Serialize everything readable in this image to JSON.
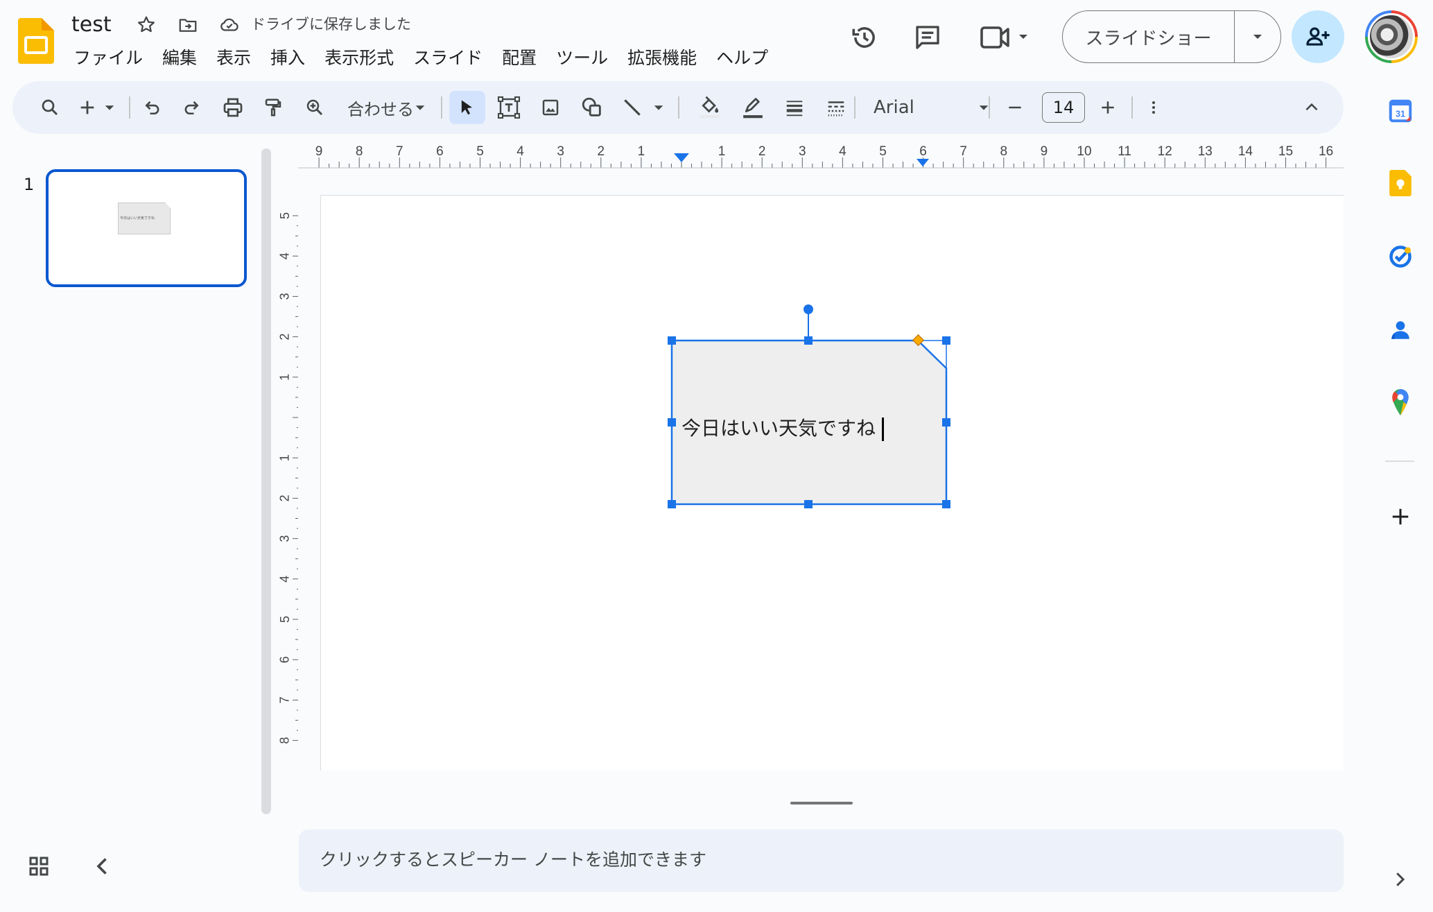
{
  "header": {
    "doc_title": "test",
    "save_status": "ドライブに保存しました",
    "menu": [
      "ファイル",
      "編集",
      "表示",
      "挿入",
      "表示形式",
      "スライド",
      "配置",
      "ツール",
      "拡張機能",
      "ヘルプ"
    ],
    "slideshow_label": "スライドショー"
  },
  "toolbar": {
    "zoom_fit_label": "合わせる",
    "font_name": "Arial",
    "font_size": "14"
  },
  "rulers": {
    "horizontal_labels": [
      "9",
      "8",
      "7",
      "6",
      "5",
      "4",
      "3",
      "2",
      "1",
      "1",
      "2",
      "3",
      "4",
      "5",
      "6",
      "7",
      "8",
      "9",
      "10",
      "11",
      "12",
      "13",
      "14",
      "15",
      "16"
    ],
    "vertical_labels": [
      "5",
      "4",
      "3",
      "2",
      "1",
      "1",
      "2",
      "3",
      "4",
      "5",
      "6",
      "7",
      "8"
    ]
  },
  "filmstrip": {
    "slides": [
      {
        "number": "1",
        "thumb_text": "今日はいい天気ですね"
      }
    ]
  },
  "slide": {
    "shape_text": "今日はいい天気ですね",
    "shape_fill": "#eeeeee",
    "selection_color": "#1a73e8",
    "adjust_handle_color": "#f9ab00"
  },
  "notes": {
    "placeholder": "クリックするとスピーカー ノートを追加できます"
  },
  "side_panel": {
    "icons": [
      "calendar-icon",
      "keep-icon",
      "tasks-icon",
      "contacts-icon",
      "maps-icon",
      "add-icon"
    ],
    "calendar_day": "31"
  },
  "colors": {
    "accent": "#0b57d0",
    "share_bg": "#c2e7ff",
    "toolbar_bg": "#edf2fa",
    "slides_yellow": "#fbbc04"
  }
}
